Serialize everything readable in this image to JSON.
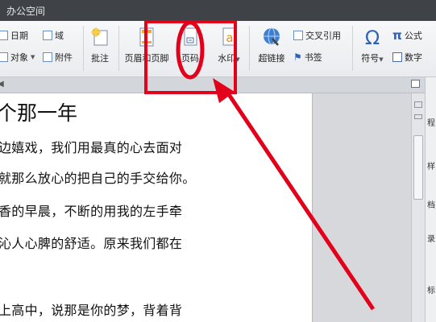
{
  "window": {
    "title": "办公空间"
  },
  "ribbon": {
    "date": "日期",
    "field": "域",
    "object": "对象",
    "attachment": "附件",
    "comment": "批注",
    "header_footer": "页眉和页脚",
    "page_number": "页码",
    "watermark": "水印",
    "hyperlink": "超链接",
    "bookmark": "书签",
    "cross_ref": "交叉引用",
    "symbol": "符号",
    "formula": "公式",
    "number": "数字"
  },
  "document": {
    "heading": "个那一年",
    "lines": [
      "边嬉戏，我们用最真的心去面对",
      "就那么放心的把自己的手交给你。",
      "香的早晨，不断的用我的左手牵",
      "沁人心脾的舒适。原来我们都在",
      "上高中，说那是你的梦，背着背"
    ]
  },
  "side_panel": {
    "chars": [
      "程",
      "样",
      "档",
      "录",
      "标"
    ]
  },
  "colors": {
    "annotation": "#e3001b",
    "title_bar": "#3f4247",
    "page": "#ffffff"
  }
}
